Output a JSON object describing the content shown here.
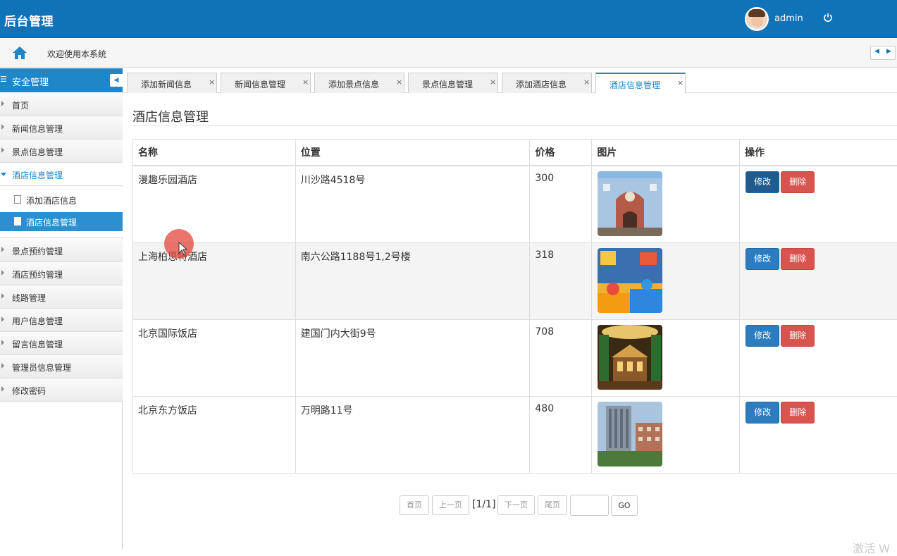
{
  "header": {
    "brand": "后台管理",
    "username": "admin"
  },
  "crumbbar": {
    "welcome": "欢迎使用本系统"
  },
  "sidebar": {
    "head": "安全管理",
    "items": [
      {
        "label": "首页"
      },
      {
        "label": "新闻信息管理"
      },
      {
        "label": "景点信息管理"
      },
      {
        "label": "酒店信息管理"
      },
      {
        "label": "景点预约管理"
      },
      {
        "label": "酒店预约管理"
      },
      {
        "label": "线路管理"
      },
      {
        "label": "用户信息管理"
      },
      {
        "label": "留言信息管理"
      },
      {
        "label": "管理员信息管理"
      },
      {
        "label": "修改密码"
      }
    ],
    "subitems": [
      {
        "label": "添加酒店信息"
      },
      {
        "label": "酒店信息管理"
      }
    ]
  },
  "tabs": [
    {
      "label": "添加新闻信息",
      "close": "×"
    },
    {
      "label": "新闻信息管理",
      "close": "×"
    },
    {
      "label": "添加景点信息",
      "close": "×"
    },
    {
      "label": "景点信息管理",
      "close": "×"
    },
    {
      "label": "添加酒店信息",
      "close": "×"
    },
    {
      "label": "酒店信息管理",
      "close": "×"
    }
  ],
  "main": {
    "title": "酒店信息管理",
    "columns": [
      "名称",
      "位置",
      "价格",
      "图片",
      "操作"
    ],
    "rows": [
      {
        "name": "漫趣乐园酒店",
        "location": "川沙路4518号",
        "price": "300",
        "edit": "修改",
        "delete": "删除"
      },
      {
        "name": "上海柏思特酒店",
        "location": "南六公路1188号1,2号楼",
        "price": "318",
        "edit": "修改",
        "delete": "删除"
      },
      {
        "name": "北京国际饭店",
        "location": "建国门内大街9号",
        "price": "708",
        "edit": "修改",
        "delete": "删除"
      },
      {
        "name": "北京东方饭店",
        "location": "万明路11号",
        "price": "480",
        "edit": "修改",
        "delete": "删除"
      }
    ]
  },
  "pager": {
    "first": "首页",
    "prev": "上一页",
    "info": "[1/1]",
    "next": "下一页",
    "last": "尾页",
    "go": "GO",
    "page_input": ""
  },
  "watermark": "激活 W",
  "colors": {
    "header_bg": "#1073b8",
    "accent": "#1f86c8",
    "edit_btn": "#2d7cc0",
    "delete_btn": "#d9534f"
  }
}
